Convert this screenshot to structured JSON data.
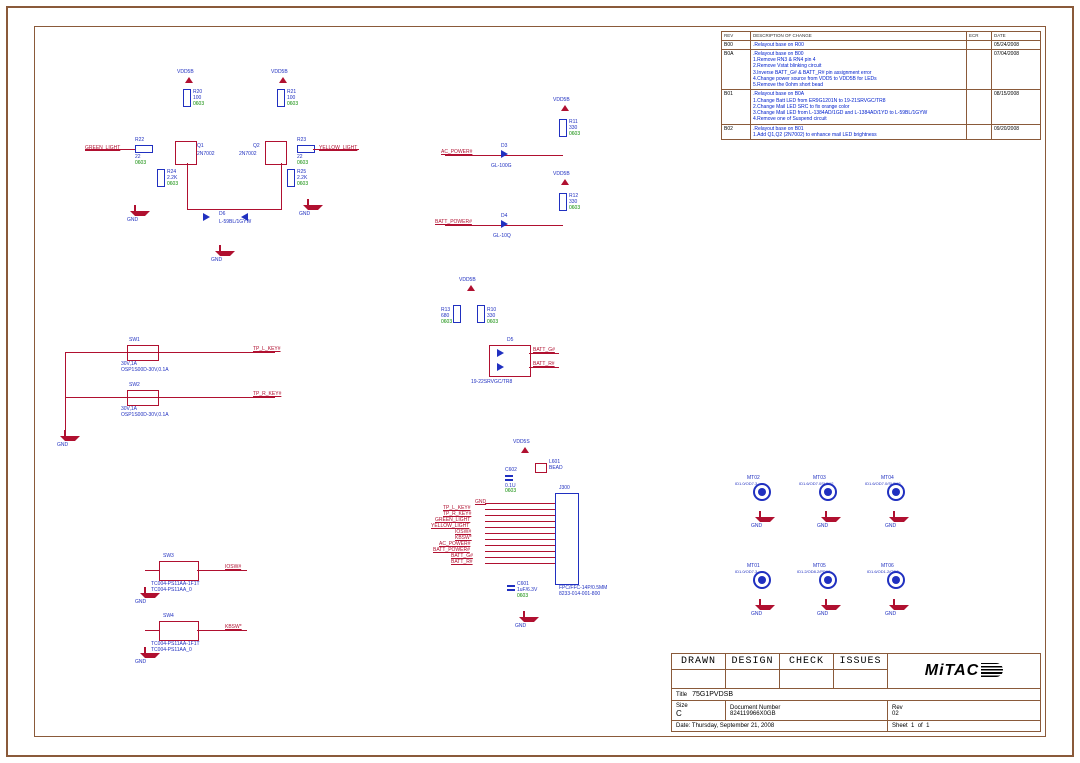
{
  "revisions": {
    "headers": [
      "REV",
      "DESCRIPTION OF CHANGE",
      "ECR",
      "DATE"
    ],
    "rows": [
      {
        "rev": "B00",
        "desc": ".Relayout base on R00",
        "date": "05/24/2008"
      },
      {
        "rev": "B0A",
        "desc": ".Relayout base on B00\n1.Remove RN3 & RN4 pin 4\n2.Remove Vstat blinking circuit\n3.Inverse BATT_G# & BATT_R# pin assignment error\n4.Change power source from VDD5 to VDD5B for LEDs\n5.Remove the 0ohm short bead",
        "date": "07/04/2008"
      },
      {
        "rev": "B01",
        "desc": ".Relayout base on B0A\n1.Change Batt LED from ER9G1201N to 19-21SRVGC/TR8\n2.Change Mail LED SRC to fix orange color\n3.Change Mail LED from L-1384AD/1GD and L-1384AD/1YD to L-59BL/1GYW\n4.Remove one of Suspend circuit",
        "date": "08/15/2008"
      },
      {
        "rev": "B02",
        "desc": ".Relayout base on B01\n1.Add Q1,Q2 (2N7002) to enhance mail LED brightness",
        "date": "09/20/2008"
      }
    ]
  },
  "rails": {
    "vdd5b": "VDD5B",
    "vdd5s": "VDD5S",
    "gnd": "GND"
  },
  "mail_led": {
    "green_net": "GREEN_LIGHT",
    "yellow_net": "YELLOW_LIGHT",
    "R20": {
      "ref": "R20",
      "val": "100",
      "pkg": "0603"
    },
    "R21": {
      "ref": "R21",
      "val": "100",
      "pkg": "0603"
    },
    "R22": {
      "ref": "R22",
      "val": "22",
      "pkg": "0603"
    },
    "R23": {
      "ref": "R23",
      "val": "22",
      "pkg": "0603"
    },
    "R24": {
      "ref": "R24",
      "val": "2.2K",
      "pkg": "0603"
    },
    "R25": {
      "ref": "R25",
      "val": "2.2K",
      "pkg": "0603"
    },
    "Q1": {
      "ref": "Q1",
      "val": "2N7002"
    },
    "Q2": {
      "ref": "Q2",
      "val": "2N7002"
    },
    "D6": {
      "ref": "D6",
      "val": "L-59BL/1GYW"
    }
  },
  "ac_power": {
    "net": "AC_POWER#",
    "D3": {
      "ref": "D3",
      "val": "GL-100G"
    },
    "R11": {
      "ref": "R11",
      "val": "330",
      "pkg": "0603"
    }
  },
  "batt_power": {
    "net": "BATT_POWER#",
    "D4": {
      "ref": "D4",
      "val": "GL-10Q"
    },
    "R12": {
      "ref": "R12",
      "val": "330",
      "pkg": "0603"
    }
  },
  "batt_dual": {
    "R13": {
      "ref": "R13",
      "val": "680",
      "pkg": "0603"
    },
    "R10": {
      "ref": "R10",
      "val": "330",
      "pkg": "0603"
    },
    "D5": {
      "ref": "D5",
      "val": "19-22SRVGC/TR8"
    },
    "net_g": "BATT_G#",
    "net_r": "BATT_R#"
  },
  "tp_keys": {
    "sw1": {
      "ref": "SW1",
      "val": "30V,1A",
      "mfg": "OSP1S00D-30V,0.1A",
      "net": "TP_L_KEY#"
    },
    "sw2": {
      "ref": "SW2",
      "val": "30V,1A",
      "mfg": "OSP1S00D-30V,0.1A",
      "net": "TP_R_KEY#"
    }
  },
  "kb_sw": {
    "sw3": {
      "ref": "SW3",
      "conn": "TC004-PS11AA-1F1T",
      "mfg": "TC004-PS11AA_0",
      "net": "IOSW#"
    },
    "sw4": {
      "ref": "SW4",
      "conn": "TC004-PS11AA-1F1T",
      "mfg": "TC004-PS11AA_0",
      "net": "KBSW*"
    }
  },
  "fpc": {
    "bead": {
      "ref": "L601",
      "val": "BEAD"
    },
    "C601": {
      "ref": "C601",
      "val": "1uF/6.3V",
      "pkg": "0603"
    },
    "C602": {
      "ref": "C602",
      "val": "0.1U",
      "pkg": "0603"
    },
    "ref": "J300",
    "val": "FPC/FFC-14P/0.5MM",
    "pn": "8233-014-001-800",
    "nets": [
      "GND",
      "TP_L_KEY#",
      "TP_R_KEY#",
      "GREEN_LIGHT",
      "YELLOW_LIGHT",
      "IOSW#",
      "KBSW*",
      "AC_POWER#",
      "BATT_POWER#",
      "BATT_G#",
      "BATT_R#"
    ],
    "pins": 14
  },
  "mt": {
    "items": [
      {
        "ref": "MT02",
        "val": "ID1.0/OD7.3"
      },
      {
        "ref": "MT03",
        "val": "ID1.6/OD7.0SLD12"
      },
      {
        "ref": "MT04",
        "val": "ID1.6/OD7.0/SLD12"
      },
      {
        "ref": "MT01",
        "val": "ID1.0/OD7.3"
      },
      {
        "ref": "MT05",
        "val": "ID1.2/OD8.2/PD02"
      },
      {
        "ref": "MT06",
        "val": "ID1.6/OD1.2/OD2"
      }
    ]
  },
  "titleblock": {
    "labels": {
      "drawn": "DRAWN",
      "design": "DESIGN",
      "check": "CHECK",
      "issues": "ISSUES"
    },
    "company": "MiTAC",
    "title_lbl": "Title",
    "title": "75G1PVDSB",
    "size_lbl": "Size",
    "size": "C",
    "doc_lbl": "Document Number",
    "doc": "824119966X0GB",
    "rev_lbl": "Rev",
    "rev": "02",
    "date_lbl": "Date:",
    "date": "Thursday, September 21, 2008",
    "sheet_lbl": "Sheet",
    "sheet_of": "of",
    "sheet_n": "1",
    "sheet_t": "1"
  }
}
